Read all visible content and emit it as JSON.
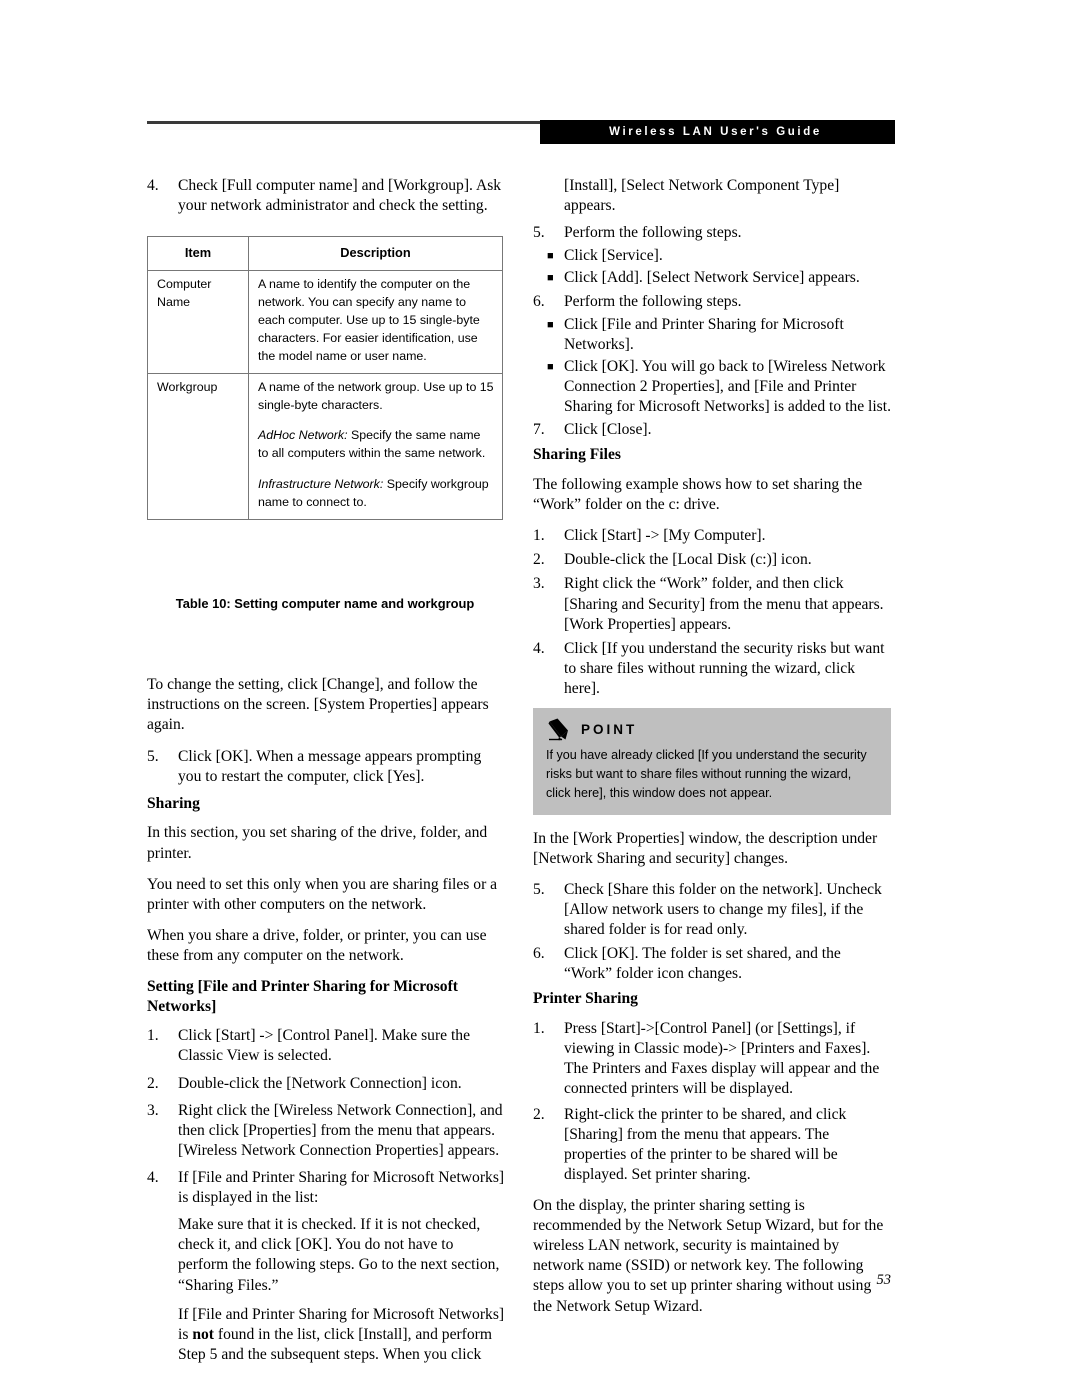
{
  "header": {
    "title": "Wireless LAN User's Guide",
    "rule_color": "#3a3a3a",
    "bar_color": "#000000"
  },
  "page_number": "53",
  "left_column": {
    "step4": {
      "num": "4.",
      "text": "Check [Full computer name] and [Workgroup]. Ask your network administrator and check the setting."
    },
    "table": {
      "caption": "Table 10: Setting computer name and workgroup",
      "headers": [
        "Item",
        "Description"
      ],
      "rows": [
        {
          "item": "Computer Name",
          "paragraphs": [
            {
              "lead": "",
              "text": "A name to identify the computer on the network. You can specify any name to each computer. Use up to 15 single-byte characters. For easier identification, use the model name or user name."
            }
          ]
        },
        {
          "item": "Workgroup",
          "paragraphs": [
            {
              "lead": "",
              "text": "A name of the network group. Use up to 15 single-byte characters."
            },
            {
              "lead": "AdHoc Network:",
              "text": " Specify the same name to all computers within the same network."
            },
            {
              "lead": "Infrastructure Network:",
              "text": " Specify workgroup name to connect to."
            }
          ]
        }
      ]
    },
    "para_change": "To change the setting, click [Change], and follow the instructions on the screen. [System Properties] appears again.",
    "step5": {
      "num": "5.",
      "text": "Click [OK]. When a message appears prompting you to restart the computer, click [Yes]."
    },
    "heading_sharing": "Sharing",
    "para_sharing_1": "In this section, you set sharing of the drive, folder, and printer.",
    "para_sharing_2": "You need to set this only when you are sharing files or a printer with other computers on the network.",
    "para_sharing_3": "When you share a drive, folder, or printer, you can use these from any computer on the network.",
    "heading_setting_fps": "Setting [File and Printer Sharing for Microsoft Networks]",
    "fps_steps": [
      {
        "num": "1.",
        "text": "Click [Start] -> [Control Panel]. Make sure the Classic View is selected."
      },
      {
        "num": "2.",
        "text": "Double-click the [Network Connection] icon."
      },
      {
        "num": "3.",
        "text": "Right click the [Wireless Network Connection], and then click [Properties] from the menu that appears. [Wireless Network Connection Properties] appears."
      },
      {
        "num": "4.",
        "text": " If [File and Printer Sharing for Microsoft Networks] is displayed in the list:"
      }
    ],
    "fps_cont_1": "Make sure that it is checked. If it is not checked, check it, and click [OK]. You do not have to perform the following steps. Go to the next section, “Sharing Files.”",
    "fps_cont_2_a": "If [File and Printer Sharing for Microsoft Networks] is ",
    "fps_cont_2_bold": "not",
    "fps_cont_2_b": " found in the list, click [Install], and perform Step 5 and the subsequent steps. When you click"
  },
  "right_column": {
    "continuation": "[Install], [Select Network Component Type] appears.",
    "step5": {
      "num": "5.",
      "text": "Perform the following steps."
    },
    "step5_bullets": [
      "Click [Service].",
      "Click [Add]. [Select Network Service] appears."
    ],
    "step6": {
      "num": "6.",
      "text": "Perform the following steps."
    },
    "step6_bullets": [
      "Click [File and Printer Sharing for Microsoft Networks].",
      "Click [OK]. You will go back to [Wireless Network Connection 2 Properties], and [File and Printer Sharing for Microsoft Networks] is added to the list."
    ],
    "step7": {
      "num": "7.",
      "text": "Click [Close]."
    },
    "heading_sharing_files": "Sharing Files",
    "para_example": "The following example shows how to set sharing the “Work” folder on the c: drive.",
    "sf_steps": [
      {
        "num": "1.",
        "text": "Click [Start] -> [My Computer]."
      },
      {
        "num": "2.",
        "text": "Double-click the [Local Disk (c:)] icon."
      },
      {
        "num": "3.",
        "text": "Right click the “Work” folder, and then click [Sharing and Security] from the menu that appears. [Work Properties] appears."
      },
      {
        "num": "4.",
        "text": "Click [If you understand the security risks but want to share files without running the wizard, click here]."
      }
    ],
    "point": {
      "icon": "pencil-icon",
      "label": "POINT",
      "body": "If you have already clicked [If you understand the security risks but want to share files without running the wizard, click here], this window does not appear.",
      "background": "#bfbfbf"
    },
    "para_work_props": "In the [Work Properties] window, the description under [Network Sharing and security] changes.",
    "sf_steps_2": [
      {
        "num": "5.",
        "text": "Check [Share this folder on the network]. Uncheck [Allow network users to change my files], if the shared folder is for read only."
      },
      {
        "num": "6.",
        "text": "Click [OK]. The folder is set shared, and the “Work” folder icon changes."
      }
    ],
    "heading_printer_sharing": "Printer Sharing",
    "ps_steps": [
      {
        "num": "1.",
        "text": "Press [Start]->[Control Panel] (or [Settings], if viewing in Classic mode)-> [Printers and Faxes]. The Printers and Faxes display will appear and the connected printers will be displayed."
      },
      {
        "num": "2.",
        "text": "Right-click the printer to be shared, and click [Sharing] from the menu that appears. The properties of the printer to be shared will be displayed. Set printer sharing."
      }
    ],
    "para_display": "On the display, the printer sharing setting is recommended by the Network Setup Wizard, but for the wireless LAN network, security is maintained by network name (SSID) or network key. The following steps allow you to set up printer sharing without using the Network Setup Wizard."
  }
}
